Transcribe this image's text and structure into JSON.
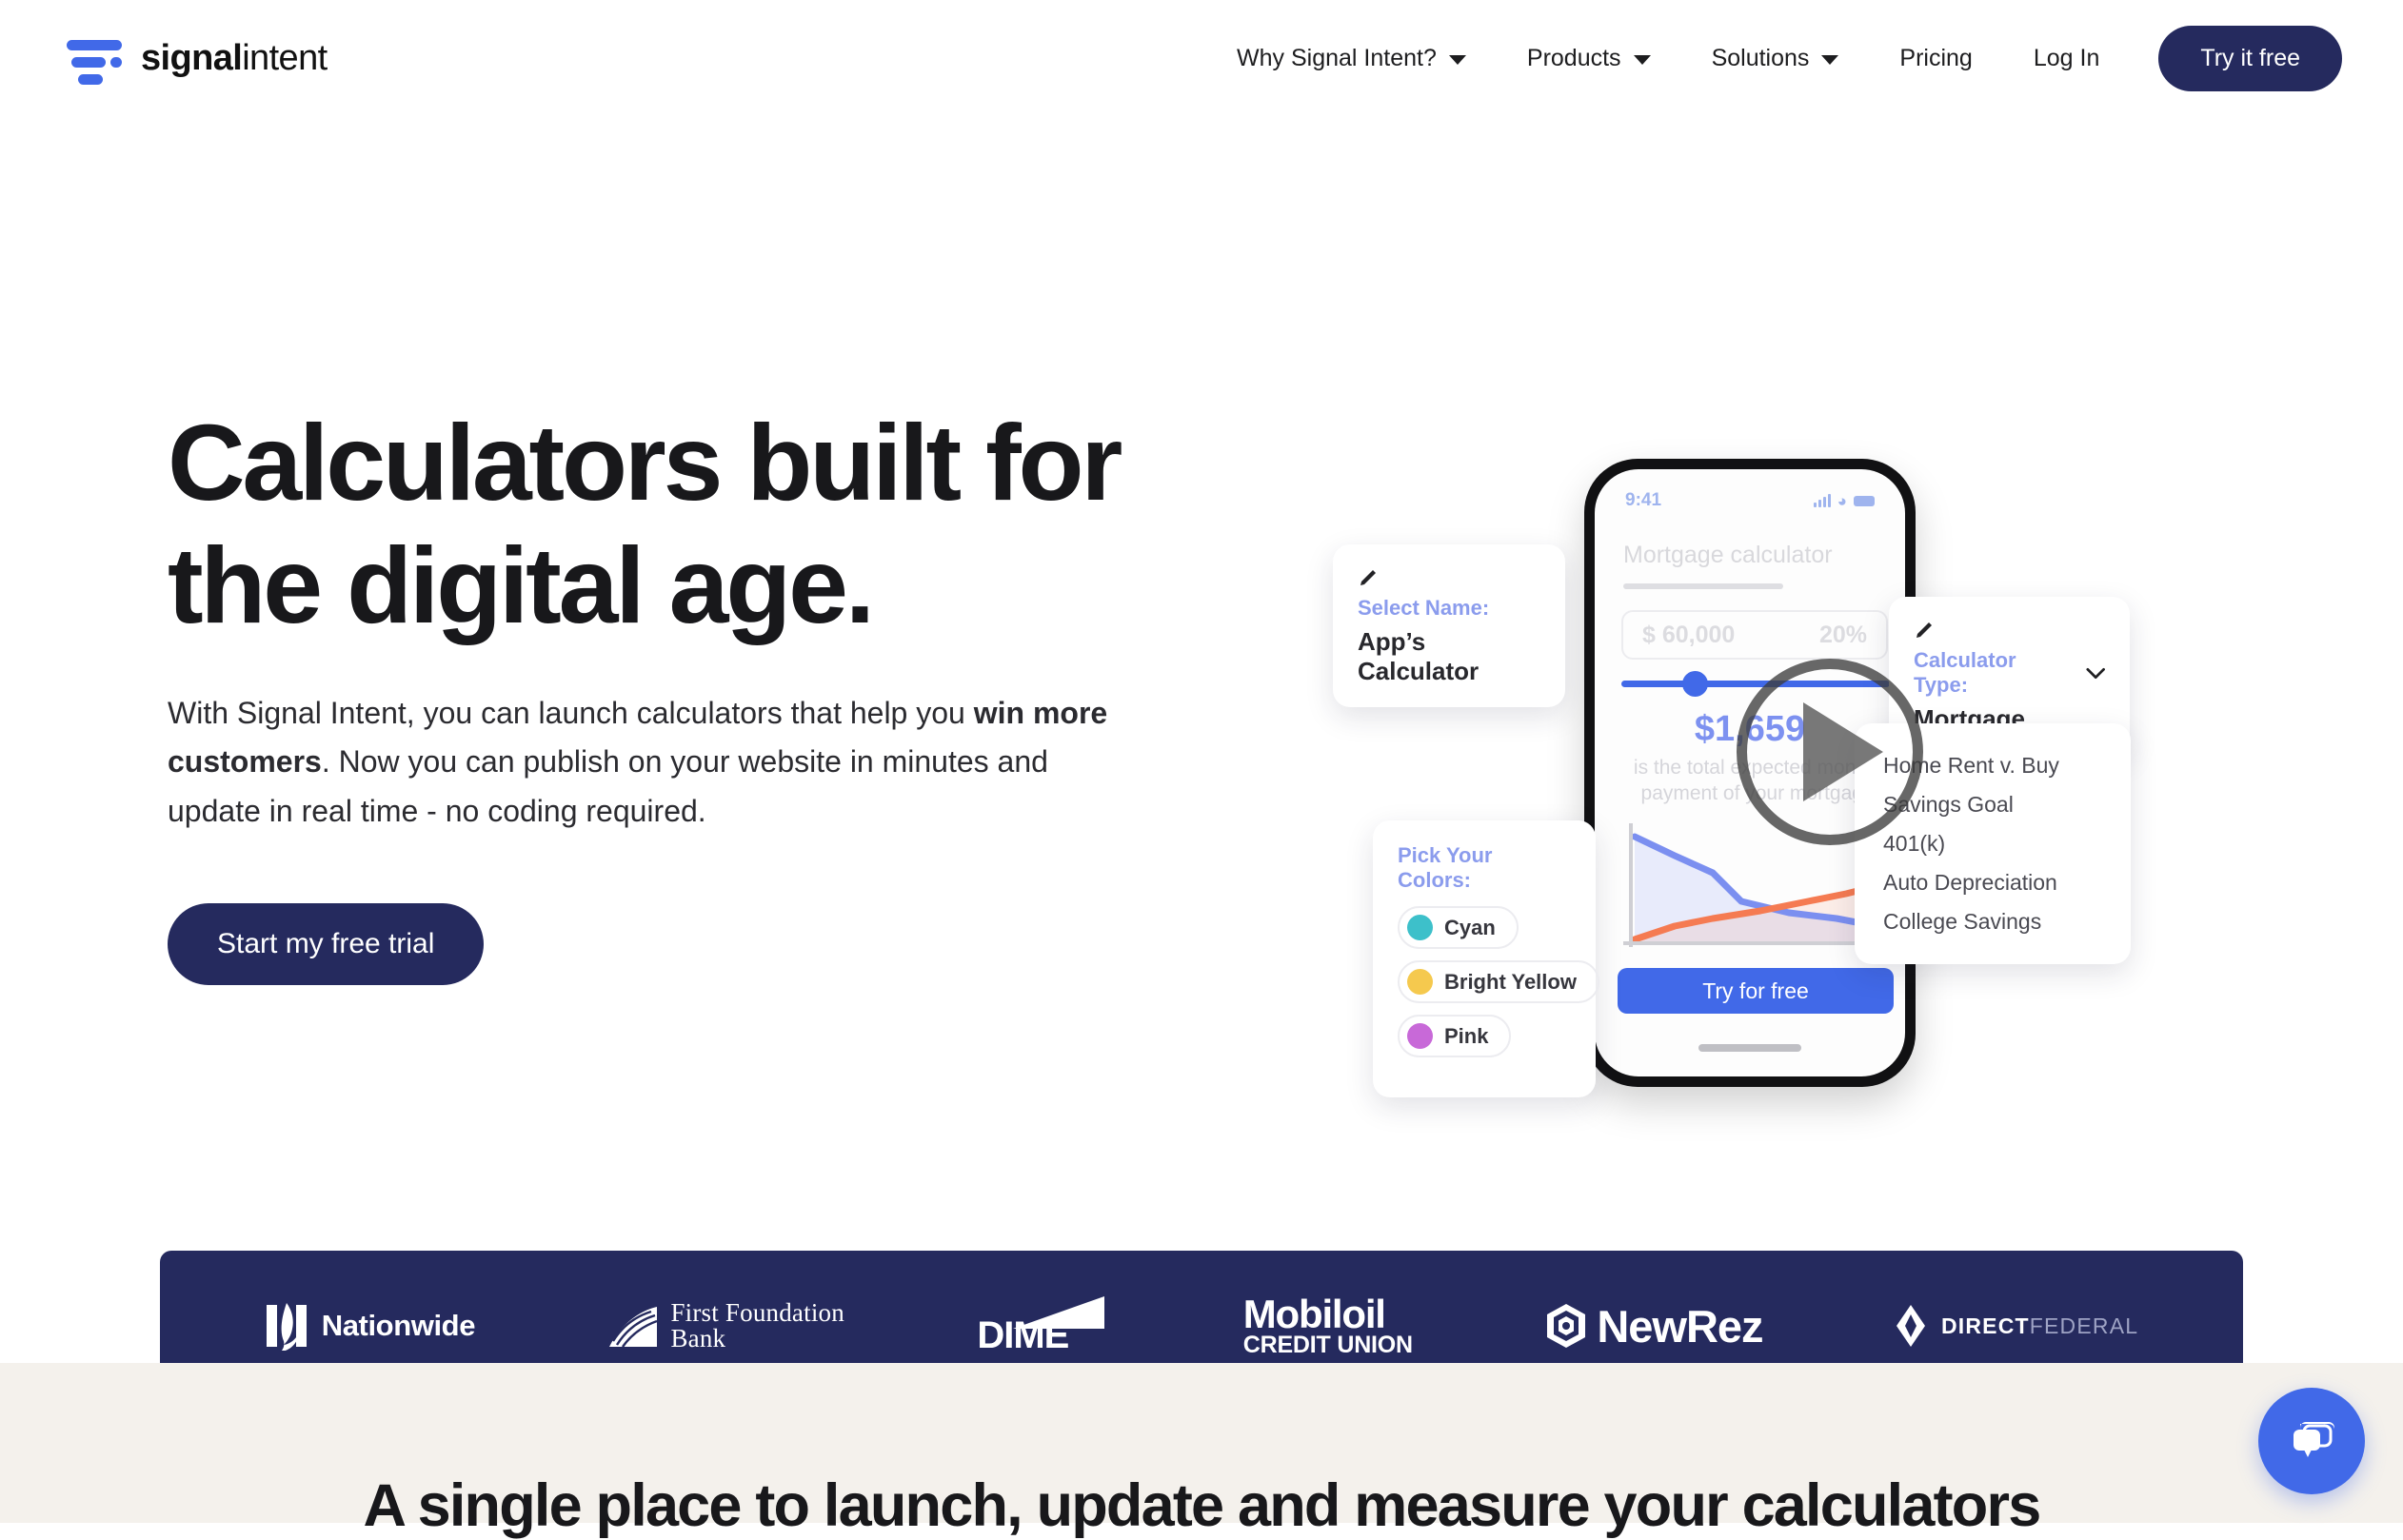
{
  "brand": {
    "part1": "signal",
    "part2": "intent",
    "logo_icon": "signal-bars-icon"
  },
  "nav": {
    "items": [
      {
        "label": "Why Signal Intent?",
        "has_caret": true
      },
      {
        "label": "Products",
        "has_caret": true
      },
      {
        "label": "Solutions",
        "has_caret": true
      },
      {
        "label": "Pricing",
        "has_caret": false
      },
      {
        "label": "Log In",
        "has_caret": false
      }
    ],
    "cta": "Try it free"
  },
  "hero": {
    "title_line1": "Calculators built for",
    "title_line2": "the digital age.",
    "body_1": "With Signal Intent, you can launch calculators that help you ",
    "body_bold": "win more customers",
    "body_2": ". Now you can publish on your website in minutes and update in real time - no coding required.",
    "cta": "Start my free trial"
  },
  "mock": {
    "phone": {
      "status_time": "9:41",
      "title": "Mortgage calculator",
      "field_amount": "$ 60,000",
      "field_percent": "20%",
      "result_amount": "$1,659",
      "result_caption": "is the total expected monthly payment of your mortgage.",
      "cta": "Try for free"
    },
    "card_name": {
      "icon": "pencil-icon",
      "label": "Select Name:",
      "value": "App’s Calculator"
    },
    "card_type": {
      "icon": "pencil-icon",
      "label": "Calculator Type:",
      "value": "Mortgage",
      "chevron": "chevron-down-icon"
    },
    "card_list": {
      "items": [
        "Home Rent v. Buy",
        "Savings Goal",
        "401(k)",
        "Auto Depreciation",
        "College Savings"
      ]
    },
    "card_colors": {
      "title": "Pick Your Colors:",
      "options": [
        {
          "name": "Cyan",
          "hex": "#3dc0ca"
        },
        {
          "name": "Bright Yellow",
          "hex": "#f5c94e"
        },
        {
          "name": "Pink",
          "hex": "#c869d8"
        }
      ]
    },
    "play_button": "play-icon"
  },
  "logos": [
    {
      "name": "Nationwide",
      "id": "logo-nationwide"
    },
    {
      "name_line1": "First Foundation",
      "name_line2": "Bank",
      "id": "logo-first-foundation-bank"
    },
    {
      "name": "DIME",
      "id": "logo-dime"
    },
    {
      "name_line1": "Mobiloil",
      "name_line2": "CREDIT UNION",
      "id": "logo-mobiloil-credit-union"
    },
    {
      "name": "NewRez",
      "id": "logo-newrez"
    },
    {
      "name_line1": "DIRECT",
      "name_line2": "FEDERAL",
      "id": "logo-direct-federal"
    }
  ],
  "section2": {
    "title": "A single place to launch, update and measure your calculators"
  },
  "chat": {
    "icon": "chat-bubble-icon"
  },
  "colors": {
    "brand_blue": "#4169e8",
    "navy": "#252a5e",
    "beige": "#f4f1ec",
    "chart_blue": "#7b8ff0",
    "chart_orange": "#f57b52"
  }
}
